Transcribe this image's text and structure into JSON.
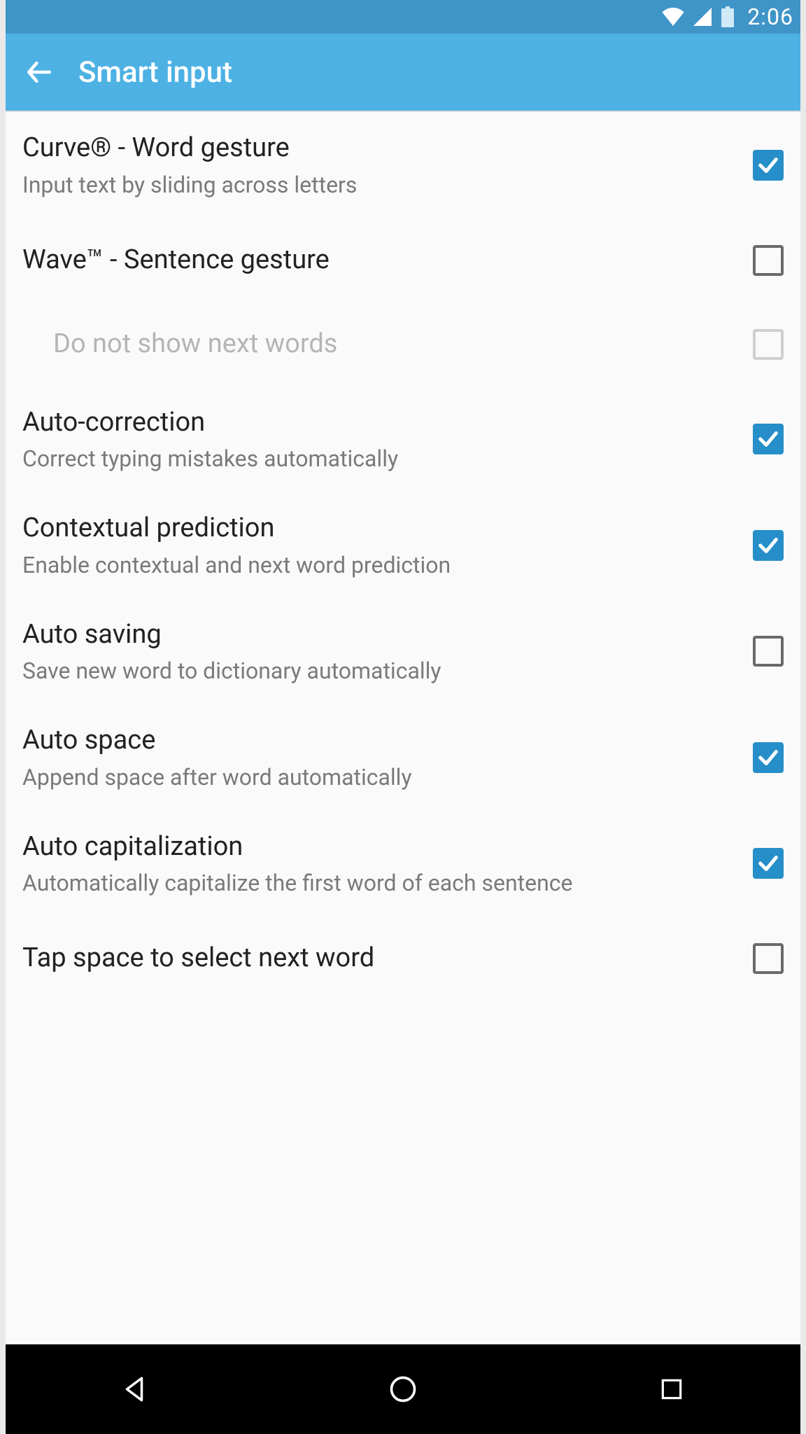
{
  "statusbar": {
    "time": "2:06"
  },
  "appbar": {
    "title": "Smart input"
  },
  "settings": [
    {
      "title": "Curve® - Word gesture",
      "subtitle": "Input text by sliding across letters",
      "checked": true,
      "disabled": false,
      "indent": false
    },
    {
      "title": "Wave™ - Sentence gesture",
      "subtitle": "",
      "checked": false,
      "disabled": false,
      "indent": false
    },
    {
      "title": "Do not show next words",
      "subtitle": "",
      "checked": false,
      "disabled": true,
      "indent": true
    },
    {
      "title": "Auto-correction",
      "subtitle": "Correct typing mistakes automatically",
      "checked": true,
      "disabled": false,
      "indent": false
    },
    {
      "title": "Contextual prediction",
      "subtitle": "Enable contextual and next word prediction",
      "checked": true,
      "disabled": false,
      "indent": false
    },
    {
      "title": "Auto saving",
      "subtitle": "Save new word to dictionary automatically",
      "checked": false,
      "disabled": false,
      "indent": false
    },
    {
      "title": "Auto space",
      "subtitle": "Append space after word automatically",
      "checked": true,
      "disabled": false,
      "indent": false
    },
    {
      "title": "Auto capitalization",
      "subtitle": "Automatically capitalize the first word of each sentence",
      "checked": true,
      "disabled": false,
      "indent": false
    },
    {
      "title": "Tap space to select next word",
      "subtitle": "",
      "checked": false,
      "disabled": false,
      "indent": false
    }
  ]
}
